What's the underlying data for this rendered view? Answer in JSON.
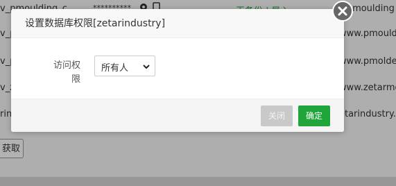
{
  "background": {
    "rows": [
      {
        "name": "v_pmoulding_c",
        "password": "**********",
        "backup": "无备份 | 导入",
        "site": "v.pmoulding"
      },
      {
        "name": "v_p",
        "password": "",
        "backup": "",
        "site": "www.pmouldec"
      },
      {
        "name": "v_p",
        "password": "",
        "backup": "",
        "site": "www.pmolded."
      },
      {
        "name": "v_z",
        "password": "",
        "backup": "",
        "site": "www.zetarmolc"
      },
      {
        "name": "rin",
        "password": "",
        "backup": "",
        "site": "etarindustry.co"
      }
    ],
    "fetch_button": "获取"
  },
  "dialog": {
    "title": "设置数据库权限[zetarindustry]",
    "access_label": "访问权限",
    "access_value": "所有人",
    "close_label": "关闭",
    "ok_label": "确定"
  },
  "colors": {
    "primary": "#20a53a",
    "disabled": "#c9c9c9"
  }
}
